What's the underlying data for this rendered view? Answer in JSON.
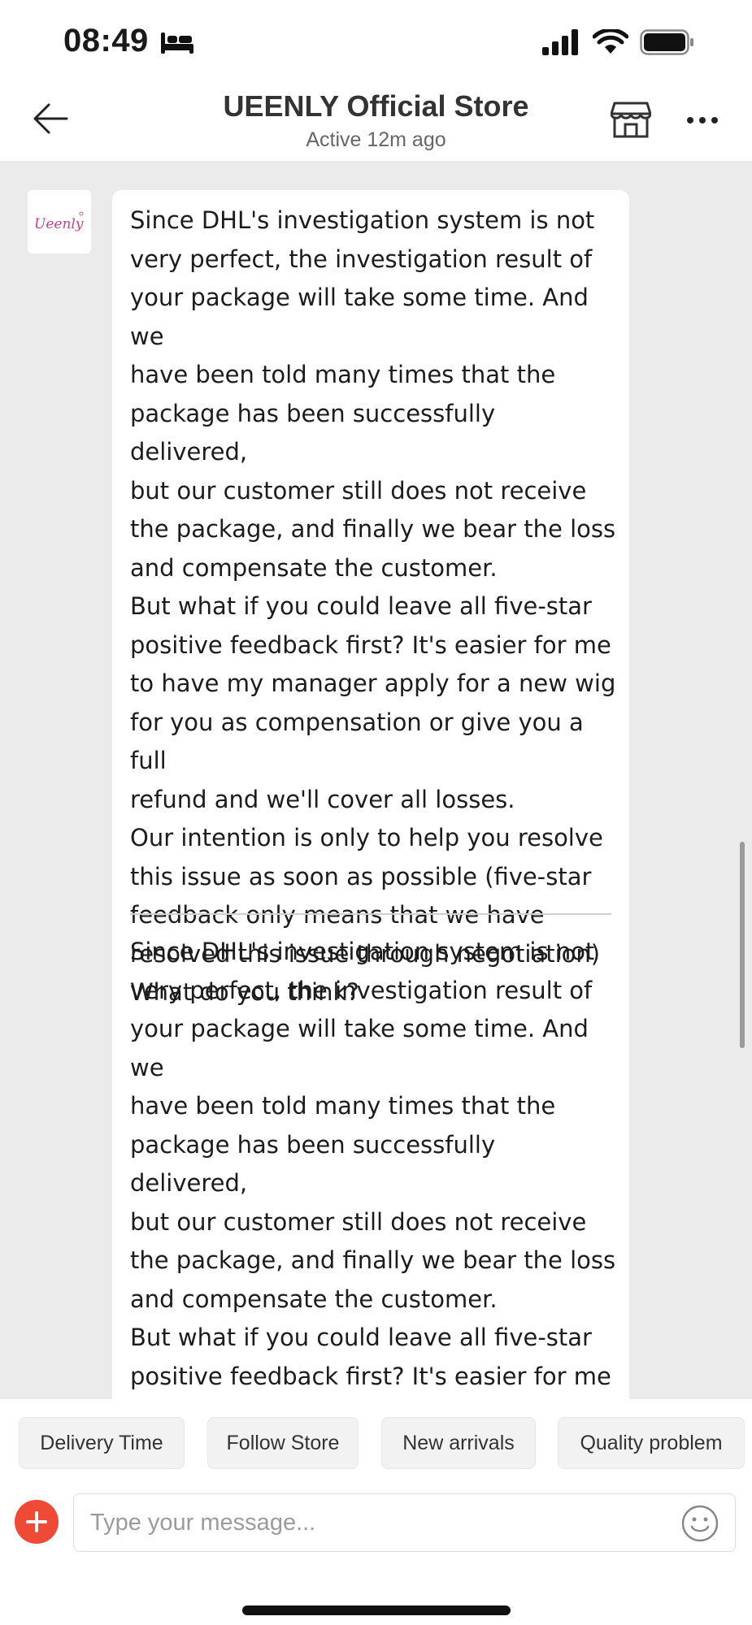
{
  "status_bar": {
    "time": "08:49",
    "icons": [
      "sleep-bed-icon",
      "cellular-signal-icon",
      "wifi-icon",
      "battery-icon"
    ]
  },
  "header": {
    "title": "UEENLY Official Store",
    "subtitle": "Active 12m ago",
    "icons": [
      "back-arrow-icon",
      "store-icon",
      "more-options-icon"
    ]
  },
  "chat": {
    "avatar_brand": "Ueenly",
    "messages": [
      {
        "sender": "store",
        "text": "Since DHL's investigation system is not\nvery perfect, the investigation result of\nyour package will take some time. And we\nhave been told many times that the\npackage has been successfully delivered,\nbut our customer still does not receive\nthe package, and finally we bear the loss\nand compensate the customer.\nBut what if you could leave all five-star\npositive feedback first? It's easier for me\nto have my manager apply for a new wig\nfor you as compensation or give you a full\nrefund and we'll cover all losses.\nOur intention is only to help you resolve\nthis issue as soon as possible (five-star\nfeedback only means that we have\nresolved this issue through negotiation)\n   What do you think?"
      },
      {
        "sender": "store",
        "text": "Since DHL's investigation system is not\nvery perfect, the investigation result of\nyour package will take some time. And we\nhave been told many times that the\npackage has been successfully delivered,\nbut our customer still does not receive\nthe package, and finally we bear the loss\nand compensate the customer.\nBut what if you could leave all five-star\npositive feedback first? It's easier for me\nto have my manager apply for a new wig\nfor you as compensation or give you a full"
      }
    ]
  },
  "quick_replies": [
    "Delivery Time",
    "Follow Store",
    "New arrivals",
    "Quality problem"
  ],
  "composer": {
    "placeholder": "Type your message...",
    "value": "",
    "icons": [
      "add-icon",
      "emoji-icon"
    ]
  },
  "colors": {
    "accent_red": "#ef4a35",
    "chat_background": "#ebebeb",
    "bubble": "#ffffff"
  }
}
